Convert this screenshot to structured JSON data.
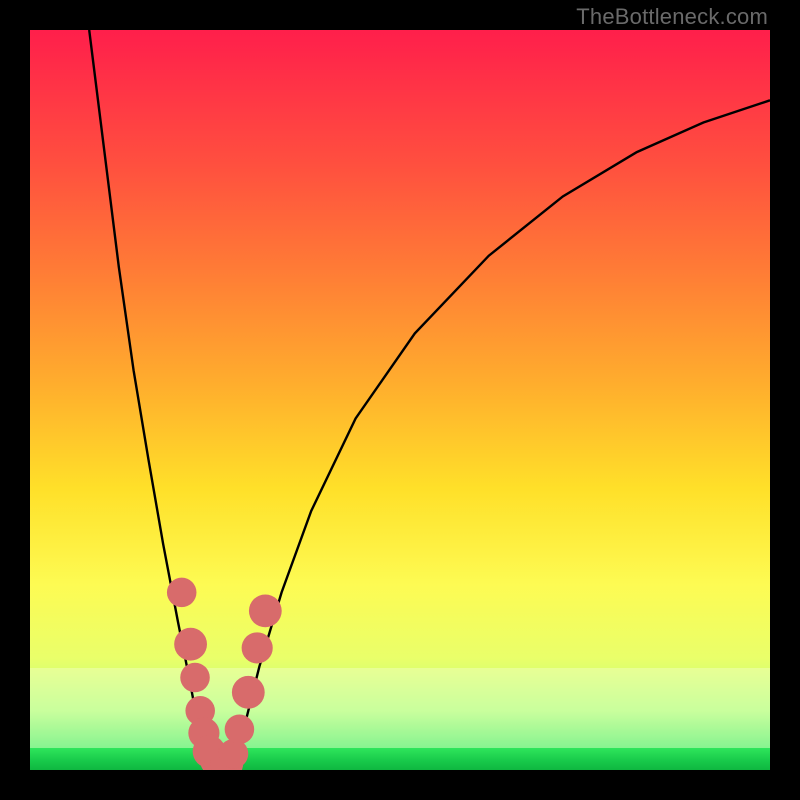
{
  "watermark": "TheBottleneck.com",
  "chart_data": {
    "type": "line",
    "title": "",
    "xlabel": "",
    "ylabel": "",
    "xlim": [
      0,
      100
    ],
    "ylim": [
      0,
      100
    ],
    "series": [
      {
        "name": "curve-left",
        "x": [
          8.0,
          10.0,
          12.0,
          14.0,
          16.0,
          18.0,
          20.0,
          21.5,
          22.5,
          23.3,
          24.0
        ],
        "values": [
          100.0,
          84.0,
          68.0,
          54.0,
          42.0,
          30.5,
          20.0,
          12.5,
          7.2,
          3.0,
          0.0
        ]
      },
      {
        "name": "curve-right",
        "x": [
          27.5,
          29.0,
          31.0,
          34.0,
          38.0,
          44.0,
          52.0,
          62.0,
          72.0,
          82.0,
          91.0,
          100.0
        ],
        "values": [
          0.0,
          6.0,
          14.0,
          24.0,
          35.0,
          47.5,
          59.0,
          69.5,
          77.5,
          83.5,
          87.5,
          90.5
        ]
      },
      {
        "name": "floor",
        "x": [
          24.0,
          27.5
        ],
        "values": [
          0.0,
          0.0
        ]
      }
    ],
    "markers": {
      "name": "highlight-dots",
      "color": "#d86b6b",
      "points": [
        {
          "x": 20.5,
          "y": 24.0,
          "r": 1.2
        },
        {
          "x": 21.7,
          "y": 17.0,
          "r": 1.4
        },
        {
          "x": 22.3,
          "y": 12.5,
          "r": 1.2
        },
        {
          "x": 23.0,
          "y": 8.0,
          "r": 1.2
        },
        {
          "x": 23.5,
          "y": 5.0,
          "r": 1.3
        },
        {
          "x": 24.2,
          "y": 2.5,
          "r": 1.4
        },
        {
          "x": 25.0,
          "y": 1.2,
          "r": 1.2
        },
        {
          "x": 25.8,
          "y": 0.7,
          "r": 1.4
        },
        {
          "x": 26.6,
          "y": 0.9,
          "r": 1.4
        },
        {
          "x": 27.5,
          "y": 2.2,
          "r": 1.2
        },
        {
          "x": 28.3,
          "y": 5.5,
          "r": 1.2
        },
        {
          "x": 29.5,
          "y": 10.5,
          "r": 1.4
        },
        {
          "x": 30.7,
          "y": 16.5,
          "r": 1.3
        },
        {
          "x": 31.8,
          "y": 21.5,
          "r": 1.4
        }
      ]
    },
    "bands": [
      {
        "name": "pale-wash",
        "y0": 3,
        "y1": 14,
        "rgba": "rgba(255,255,255,0.28)"
      },
      {
        "name": "green-floor",
        "y0": 0,
        "y1": 3,
        "rgba": "#17c94a"
      }
    ]
  }
}
